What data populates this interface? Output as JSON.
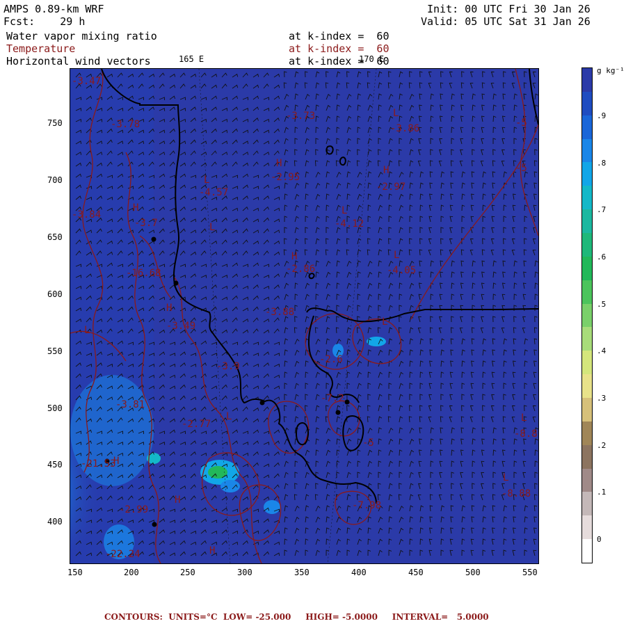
{
  "header": {
    "model": "AMPS 0.89-km WRF",
    "forecast": "Fcst:    29 h",
    "init": "Init: 00 UTC Fri 30 Jan 26",
    "valid": "Valid: 05 UTC Sat 31 Jan 26"
  },
  "fields": [
    {
      "name": "Water vapor mixing ratio",
      "level": "at k-index =  60",
      "color": "#000000"
    },
    {
      "name": "Temperature",
      "level": "at k-index =  60",
      "color": "#8b1a1a"
    },
    {
      "name": "Horizontal wind vectors",
      "level": "at k-index =  60",
      "color": "#000000"
    }
  ],
  "longitude_labels": [
    "165 E",
    "170 E"
  ],
  "axes": {
    "x_ticks": [
      "150",
      "200",
      "250",
      "300",
      "350",
      "400",
      "450",
      "500",
      "550"
    ],
    "y_ticks": [
      "750",
      "700",
      "650",
      "600",
      "550",
      "500",
      "450",
      "400"
    ]
  },
  "temperature_labels": [
    "-3.47",
    "-3.73",
    "-3.78",
    "-3.86",
    "-5",
    "-5",
    "-4.57",
    "-2.95",
    "-2.97",
    "-4.12",
    "-3.84",
    "-3.7",
    "-2.86",
    "-4.05",
    "-16.68",
    "-3.49",
    "-3.88",
    "-3.9",
    "-2.77",
    "-3.81",
    "-7.2",
    "-2.6",
    "-5",
    "-21.53",
    "-7.98",
    "-8.8",
    "-8.88",
    "-22.24",
    "-2.99"
  ],
  "extrema_markers": [
    "L",
    "L",
    "H",
    "H",
    "L",
    "L",
    "H",
    "L",
    "H",
    "L",
    "H",
    "L",
    "H",
    "L",
    "H",
    "L",
    "L",
    "H"
  ],
  "colorbar": {
    "unit": "g kg⁻¹",
    "labels": [
      ".9",
      ".8",
      ".7",
      ".6",
      ".5",
      ".4",
      ".3",
      ".2",
      ".1",
      "0"
    ],
    "colors": [
      "#2b3aa8",
      "#1f4cc0",
      "#1a66d8",
      "#1a86e8",
      "#12a6e8",
      "#14b8c8",
      "#1cb8a0",
      "#1fb87a",
      "#22b85a",
      "#4cc45c",
      "#7ad06a",
      "#a8dc7a",
      "#d4e67c",
      "#e8e28a",
      "#d6c07a",
      "#a08658",
      "#8c7460",
      "#a08a88",
      "#c4b8b8",
      "#e6dcdc",
      "#ffffff"
    ]
  },
  "footer": "CONTOURS:  UNITS=°C  LOW= -25.000     HIGH= -5.0000     INTERVAL=   5.0000"
}
